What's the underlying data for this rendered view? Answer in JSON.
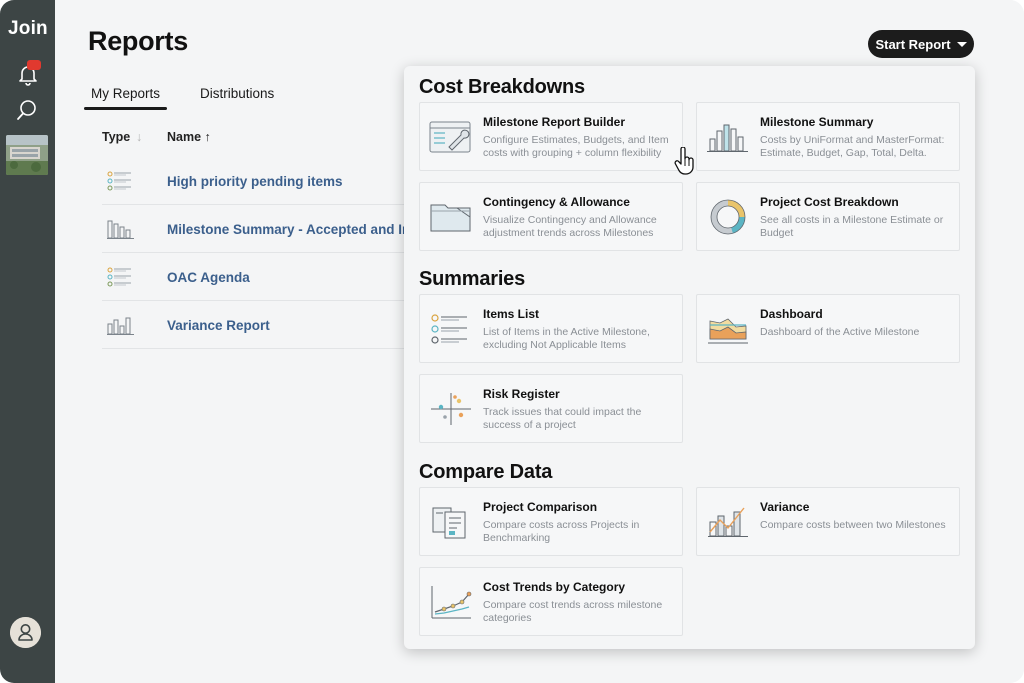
{
  "sidebar": {
    "logo": "Join"
  },
  "page": {
    "title": "Reports",
    "start_button": "Start Report"
  },
  "tabs": [
    {
      "label": "My Reports",
      "active": true
    },
    {
      "label": "Distributions",
      "active": false
    }
  ],
  "table": {
    "col_type": "Type",
    "col_name": "Name",
    "rows": [
      {
        "name": "High priority pending items",
        "icon": "items-list-icon"
      },
      {
        "name": "Milestone Summary - Accepted and In",
        "icon": "bar-chart-icon"
      },
      {
        "name": "OAC Agenda",
        "icon": "items-list-icon"
      },
      {
        "name": "Variance Report",
        "icon": "bar-chart-icon"
      }
    ]
  },
  "panel": {
    "sections": [
      {
        "title": "Cost Breakdowns",
        "cards": [
          {
            "title": "Milestone Report Builder",
            "desc": "Configure Estimates, Budgets, and Item costs with grouping + column flexibility",
            "icon": "report-builder-icon"
          },
          {
            "title": "Milestone Summary",
            "desc": "Costs by UniFormat and MasterFormat: Estimate, Budget, Gap, Total, Delta.",
            "icon": "bar-chart-icon"
          },
          {
            "title": "Contingency & Allowance",
            "desc": "Visualize Contingency and Allowance adjustment trends across Milestones",
            "icon": "folder-chart-icon"
          },
          {
            "title": "Project Cost Breakdown",
            "desc": "See all costs in a Milestone Estimate or Budget",
            "icon": "donut-chart-icon"
          }
        ]
      },
      {
        "title": "Summaries",
        "cards": [
          {
            "title": "Items List",
            "desc": "List of Items in the Active Milestone, excluding Not Applicable Items",
            "icon": "items-list-icon"
          },
          {
            "title": "Dashboard",
            "desc": "Dashboard of the Active Milestone",
            "icon": "dashboard-icon"
          },
          {
            "title": "Risk Register",
            "desc": "Track issues that could impact the success of a project",
            "icon": "risk-register-icon"
          }
        ]
      },
      {
        "title": "Compare Data",
        "cards": [
          {
            "title": "Project Comparison",
            "desc": "Compare costs across Projects in Benchmarking",
            "icon": "project-comparison-icon"
          },
          {
            "title": "Variance",
            "desc": "Compare costs between two Milestones",
            "icon": "variance-icon"
          },
          {
            "title": "Cost Trends by Category",
            "desc": "Compare cost trends across milestone categories",
            "icon": "trend-line-icon"
          }
        ]
      }
    ]
  },
  "colors": {
    "sidebar": "#3d4545",
    "link": "#3b5f8c",
    "badge": "#e1392f",
    "accent_teal": "#5bb5c4",
    "accent_yellow": "#e9c46a"
  }
}
